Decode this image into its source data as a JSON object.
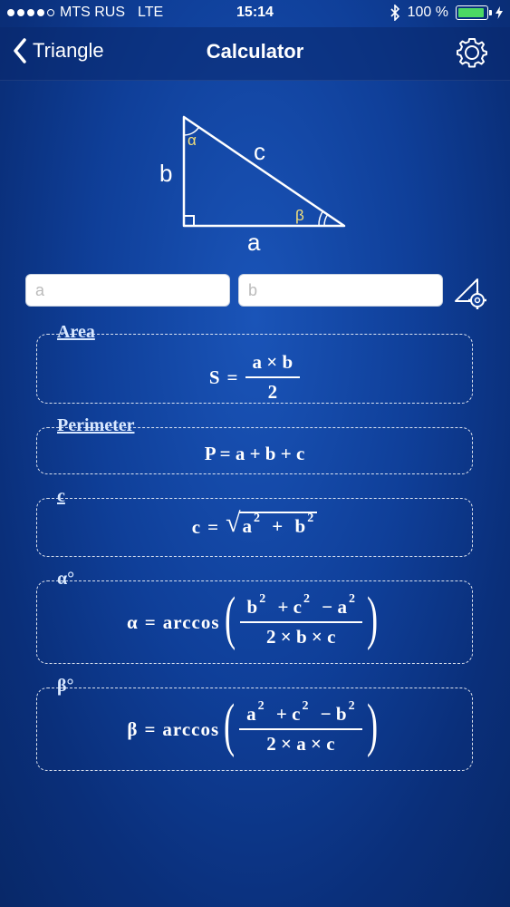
{
  "status_bar": {
    "carrier": "MTS RUS",
    "network": "LTE",
    "time": "15:14",
    "battery": "100 %",
    "battery_level": 1.0
  },
  "navbar": {
    "back_label": "Triangle",
    "title": "Calculator"
  },
  "diagram": {
    "side_a": "a",
    "side_b": "b",
    "side_c": "c",
    "angle_alpha": "α",
    "angle_beta": "β"
  },
  "inputs": {
    "a_placeholder": "a",
    "b_placeholder": "b"
  },
  "formulas": {
    "area": {
      "label": "Area",
      "lhs": "S",
      "eq": "=",
      "numerator": "a × b",
      "denominator": "2"
    },
    "perimeter": {
      "label": "Perimeter",
      "expr": "P = a + b + c"
    },
    "c": {
      "label": "c",
      "lhs": "c",
      "eq": "=",
      "radical": "√",
      "a": "a",
      "b": "b",
      "plus": "+",
      "exp": "2"
    },
    "alpha": {
      "label": "α°",
      "lhs": "α",
      "eq": "=",
      "func": "arccos",
      "numerator_parts": [
        "b",
        "2",
        "+ c",
        "2",
        "− a",
        "2"
      ],
      "denominator": "2 × b × c"
    },
    "beta": {
      "label": "β°",
      "lhs": "β",
      "eq": "=",
      "func": "arccos",
      "numerator_parts": [
        "a",
        "2",
        "+ c",
        "2",
        "− b",
        "2"
      ],
      "denominator": "2 × a × c"
    }
  },
  "colors": {
    "background": "#0f3f99",
    "triangle_stroke": "#ffffff",
    "angle_label": "#f4e07a",
    "battery_fill": "#4cd964"
  }
}
